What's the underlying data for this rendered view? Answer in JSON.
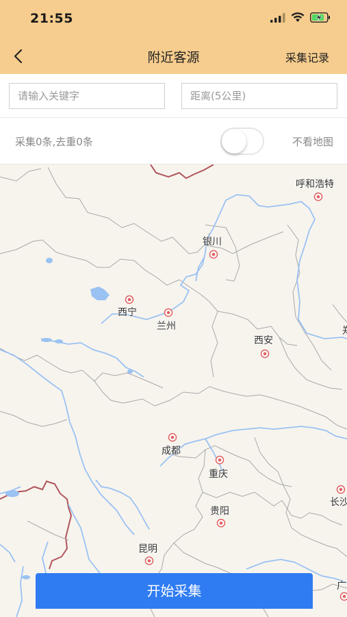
{
  "status_bar": {
    "time": "21:55",
    "icons": [
      "signal-icon",
      "wifi-icon",
      "battery-charging-icon"
    ]
  },
  "nav": {
    "title": "附近客源",
    "right_label": "采集记录",
    "back_icon": "chevron-left-icon"
  },
  "search": {
    "keyword_placeholder": "请输入关键字",
    "distance_placeholder": "距离(5公里)"
  },
  "info": {
    "count_text": "采集0条,去重0条",
    "toggle_on": false,
    "toggle_label": "不看地图"
  },
  "map": {
    "cities": [
      {
        "name": "呼和浩特"
      },
      {
        "name": "银川"
      },
      {
        "name": "西宁"
      },
      {
        "name": "兰州"
      },
      {
        "name": "西安"
      },
      {
        "name": "郑"
      },
      {
        "name": "成都"
      },
      {
        "name": "重庆"
      },
      {
        "name": "贵阳"
      },
      {
        "name": "长沙"
      },
      {
        "name": "昆明"
      },
      {
        "name": "广"
      }
    ]
  },
  "actions": {
    "start_label": "开始采集"
  },
  "colors": {
    "header_bg": "#f6cd8e",
    "primary_button": "#2f7bf2",
    "river": "#9ac2f2",
    "border": "#9a9a9a",
    "national_border": "#b0555a"
  }
}
